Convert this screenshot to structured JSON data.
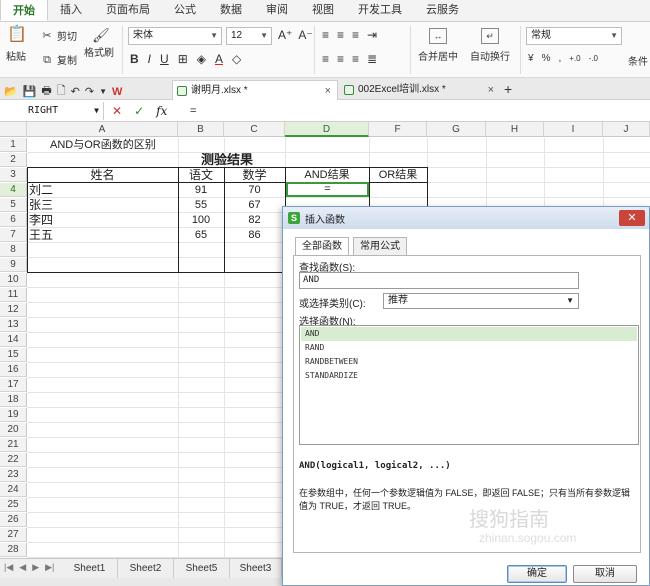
{
  "ribbon": {
    "tabs": [
      {
        "label": "开始",
        "active": true
      },
      {
        "label": "插入"
      },
      {
        "label": "页面布局"
      },
      {
        "label": "公式"
      },
      {
        "label": "数据"
      },
      {
        "label": "审阅"
      },
      {
        "label": "视图"
      },
      {
        "label": "开发工具"
      },
      {
        "label": "云服务"
      }
    ],
    "paste": "粘贴",
    "cut": "剪切",
    "copy": "复制",
    "format_painter": "格式刷",
    "font_name": "宋体",
    "font_size": "12",
    "merge_center": "合并居中",
    "wrap_text": "自动换行",
    "number_format": "常规",
    "percent": "%",
    "conditional": "条件"
  },
  "documents": [
    {
      "name": "谢明月.xlsx *",
      "active": true
    },
    {
      "name": "002Excel培训.xlsx *",
      "active": false
    }
  ],
  "formula_bar": {
    "name_box": "RIGHT",
    "content": "="
  },
  "grid": {
    "columns": [
      "A",
      "B",
      "C",
      "D",
      "F",
      "G",
      "H",
      "I",
      "J"
    ],
    "rows": [
      "1",
      "2",
      "3",
      "4",
      "5",
      "6",
      "7",
      "8",
      "9",
      "10",
      "11",
      "12",
      "13",
      "14",
      "15",
      "16",
      "17",
      "18",
      "19",
      "20",
      "21",
      "22",
      "23",
      "24",
      "25",
      "26",
      "27",
      "28"
    ],
    "selected_column": "D",
    "selected_row": "4",
    "a1": "AND与OR函数的区别",
    "title": "测验结果",
    "headers": [
      "姓名",
      "语文",
      "数学",
      "AND结果",
      "OR结果"
    ],
    "records": [
      {
        "name": "刘二",
        "chinese": "91",
        "math": "70",
        "and": "="
      },
      {
        "name": "张三",
        "chinese": "55",
        "math": "67"
      },
      {
        "name": "李四",
        "chinese": "100",
        "math": "82"
      },
      {
        "name": "王五",
        "chinese": "65",
        "math": "86"
      }
    ]
  },
  "sheets": [
    "Sheet1",
    "Sheet2",
    "Sheet5",
    "Sheet3"
  ],
  "dialog": {
    "title": "插入函数",
    "tabs": [
      "全部函数",
      "常用公式"
    ],
    "search_label": "查找函数(S):",
    "search_value": "AND",
    "category_label": "或选择类别(C):",
    "category_value": "推荐",
    "function_label": "选择函数(N):",
    "functions": [
      "AND",
      "RAND",
      "RANDBETWEEN",
      "STANDARDIZE"
    ],
    "signature": "AND(logical1, logical2, ...)",
    "description": "在参数组中，任何一个参数逻辑值为 FALSE，即返回 FALSE；只有当所有参数逻辑值为 TRUE，才返回 TRUE。",
    "ok": "确定",
    "cancel": "取消"
  },
  "watermark": {
    "main": "搜狗指南",
    "sub": "zhinan.sogou.com"
  },
  "colors": {
    "accent": "#2b7a2b",
    "selection": "#e2efda",
    "dialog_close": "#c9453a"
  }
}
